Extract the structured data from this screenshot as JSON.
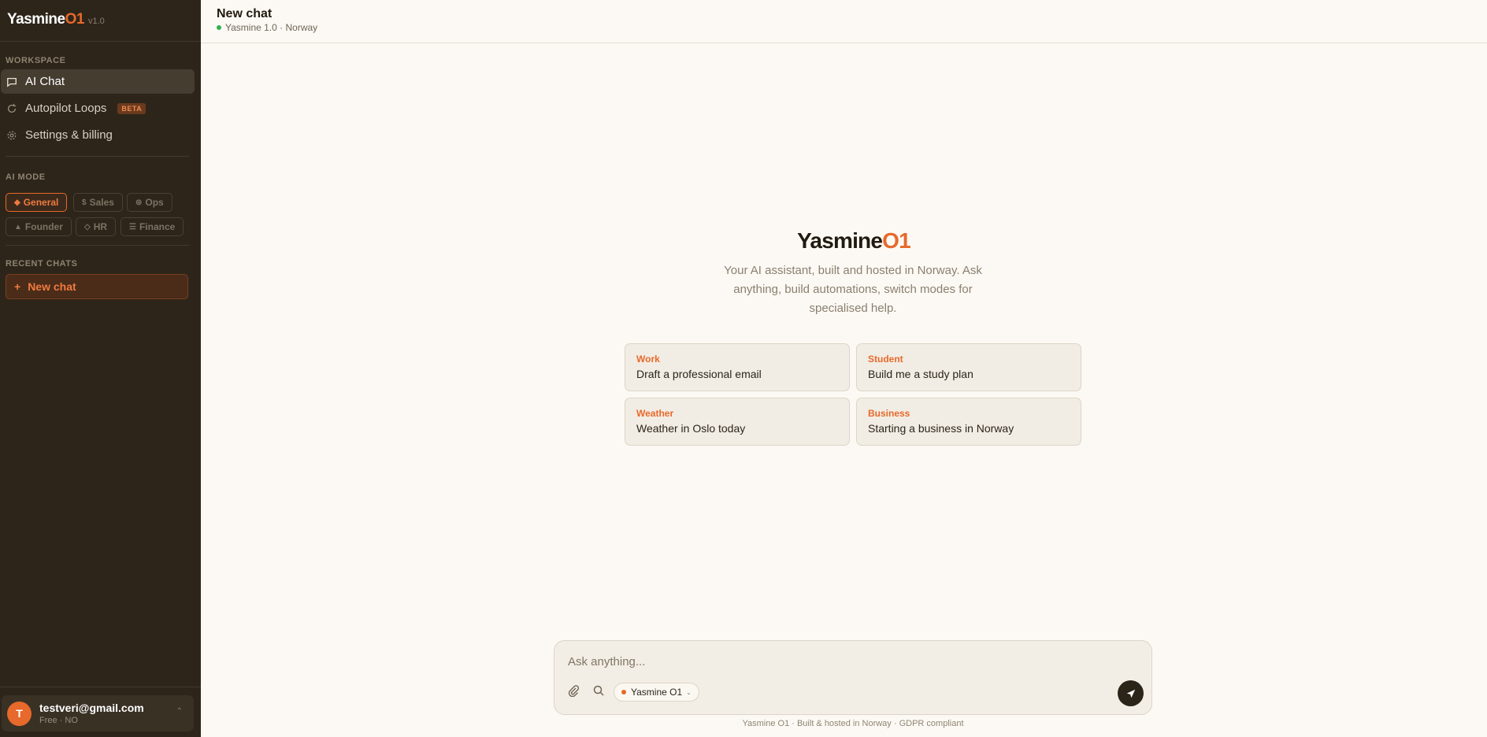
{
  "brand": {
    "name_main": "Yasmine",
    "name_accent": "O1",
    "version": "v1.0"
  },
  "sidebar": {
    "workspace_label": "WORKSPACE",
    "nav": [
      {
        "label": "AI Chat",
        "icon": "chat-icon",
        "active": true
      },
      {
        "label": "Autopilot Loops",
        "icon": "loop-icon",
        "badge": "BETA"
      },
      {
        "label": "Settings & billing",
        "icon": "gear-icon"
      }
    ],
    "mode_label": "AI MODE",
    "modes": [
      {
        "glyph": "◆",
        "label": "General",
        "active": true
      },
      {
        "glyph": "$",
        "label": "Sales"
      },
      {
        "glyph": "⊜",
        "label": "Ops"
      },
      {
        "glyph": "▲",
        "label": "Founder"
      },
      {
        "glyph": "◇",
        "label": "HR"
      },
      {
        "glyph": "☰",
        "label": "Finance"
      }
    ],
    "recent_label": "RECENT CHATS",
    "new_chat": {
      "plus": "+",
      "label": "New chat"
    }
  },
  "user": {
    "initial": "T",
    "email": "testveri@gmail.com",
    "plan": "Free · NO",
    "chevron": "⌃"
  },
  "header": {
    "title": "New chat",
    "subtitle": "Yasmine 1.0 · Norway",
    "status_color": "#2fb24f"
  },
  "hero": {
    "title_main": "Yasmine",
    "title_accent": "O1",
    "description": "Your AI assistant, built and hosted in Norway. Ask anything, build automations, switch modes for specialised help."
  },
  "suggestions": [
    {
      "category": "Work",
      "text": "Draft a professional email"
    },
    {
      "category": "Student",
      "text": "Build me a study plan"
    },
    {
      "category": "Weather",
      "text": "Weather in Oslo today"
    },
    {
      "category": "Business",
      "text": "Starting a business in Norway"
    }
  ],
  "composer": {
    "placeholder": "Ask anything...",
    "value": "",
    "model_label": "Yasmine O1",
    "model_chevron": "⌄",
    "footnote": "Yasmine O1 · Built & hosted in Norway · GDPR compliant"
  },
  "colors": {
    "accent": "#e7692b",
    "sidebar_bg": "#2d251a",
    "page_bg": "#fcf9f4"
  }
}
